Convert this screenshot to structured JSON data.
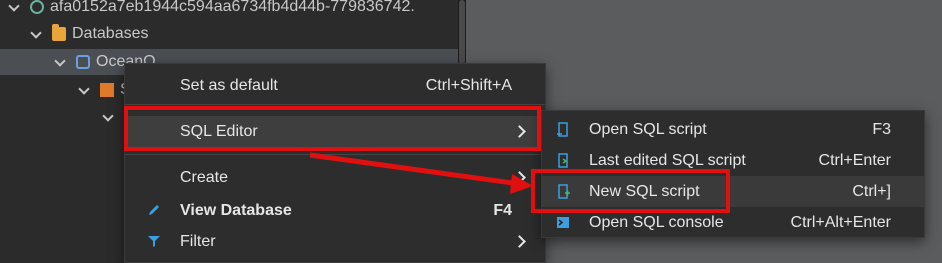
{
  "tree": {
    "connection": "afa0152a7eb1944c594aa6734fb4d44b-779836742.",
    "databases_label": "Databases",
    "database_name": "OceanO",
    "schema_name": "S"
  },
  "context_menu": {
    "items": [
      {
        "label": "Set as default",
        "shortcut": "Ctrl+Shift+A"
      },
      {
        "label": "SQL Editor",
        "shortcut": ""
      },
      {
        "label": "Create",
        "shortcut": ""
      },
      {
        "label": "View Database",
        "shortcut": "F4"
      },
      {
        "label": "Filter",
        "shortcut": ""
      }
    ]
  },
  "submenu": {
    "items": [
      {
        "label": "Open SQL script",
        "shortcut": "F3"
      },
      {
        "label": "Last edited SQL script",
        "shortcut": "Ctrl+Enter"
      },
      {
        "label": "New SQL script",
        "shortcut": "Ctrl+]"
      },
      {
        "label": "Open SQL console",
        "shortcut": "Ctrl+Alt+Enter"
      }
    ]
  },
  "colors": {
    "highlight_red": "#e01010",
    "menu_bg": "#2d2d2d",
    "icon_accent": "#3aa0e0"
  },
  "icons": {
    "pencil": "pencil-icon",
    "filter": "filter-icon",
    "sql_script": "sql-script-icon",
    "console": "console-icon"
  }
}
